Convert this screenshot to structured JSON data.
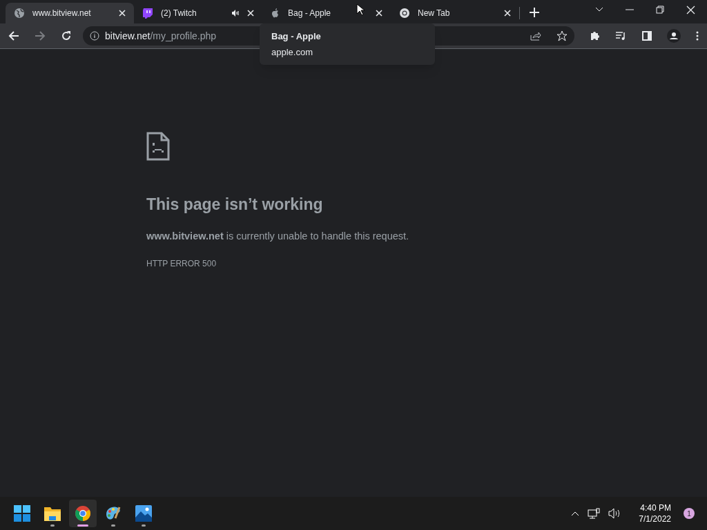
{
  "tabs": [
    {
      "title": "www.bitview.net",
      "kind": "globe",
      "selected": true,
      "audio": false
    },
    {
      "title": "(2) Twitch",
      "kind": "twitch",
      "selected": false,
      "audio": true
    },
    {
      "title": "Bag - Apple",
      "kind": "apple",
      "selected": false,
      "audio": false
    },
    {
      "title": "New Tab",
      "kind": "chrome",
      "selected": false,
      "audio": false
    }
  ],
  "tooltip": {
    "title": "Bag - Apple",
    "subtitle": "apple.com"
  },
  "address": {
    "host": "bitview.net",
    "path": "/my_profile.php"
  },
  "error": {
    "title": "This page isn’t working",
    "message": "**www.bitview.net** is currently unable to handle this request.",
    "code": "HTTP ERROR 500"
  },
  "taskbar": {
    "apps": [
      {
        "kind": "start",
        "running": false,
        "selected": false
      },
      {
        "kind": "folder",
        "running": true,
        "selected": false
      },
      {
        "kind": "chrome",
        "running": true,
        "selected": true
      },
      {
        "kind": "paint",
        "running": true,
        "selected": false
      },
      {
        "kind": "photos",
        "running": true,
        "selected": false
      }
    ],
    "time": "4:40 PM",
    "date": "7/1/2022",
    "notifications": "1"
  }
}
